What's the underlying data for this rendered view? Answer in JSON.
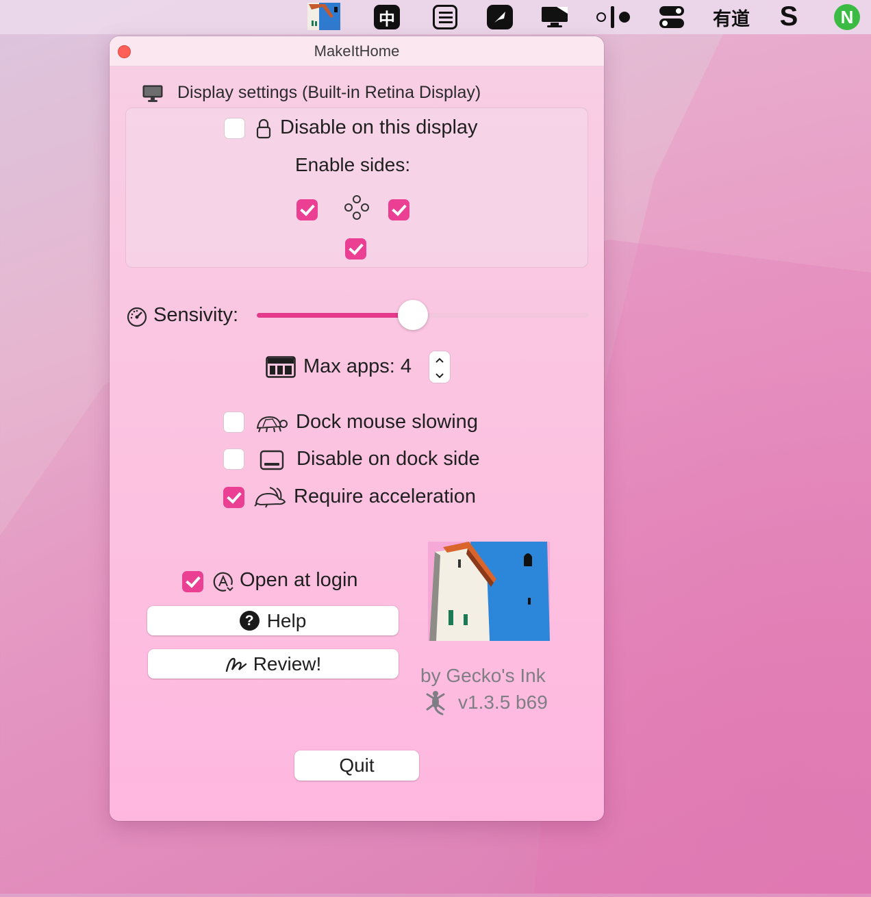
{
  "menubar": {
    "items": [
      {
        "name": "makeithome-app-icon"
      },
      {
        "name": "chinese-input-icon",
        "label": "中"
      },
      {
        "name": "list-icon"
      },
      {
        "name": "feather-icon"
      },
      {
        "name": "display-icon"
      },
      {
        "name": "dots-icon"
      },
      {
        "name": "toggle-icon"
      },
      {
        "name": "youdao-icon",
        "label": "有道"
      },
      {
        "name": "s-app-icon",
        "label": "S"
      },
      {
        "name": "n-app-icon",
        "label": "N"
      }
    ]
  },
  "window": {
    "title": "MakeItHome",
    "display_section": {
      "header": "Display settings (Built-in Retina Display)",
      "disable_on_display": {
        "label": "Disable on this display",
        "checked": false
      },
      "enable_sides_label": "Enable sides:",
      "sides": {
        "left": true,
        "right": true,
        "bottom": true
      }
    },
    "sensitivity": {
      "label": "Sensivity:",
      "value_fraction": 0.47
    },
    "max_apps": {
      "label": "Max apps: 4"
    },
    "options": [
      {
        "key": "dock_mouse_slowing",
        "label": "Dock mouse slowing",
        "checked": false,
        "icon": "turtle-icon"
      },
      {
        "key": "disable_on_dock_side",
        "label": "Disable on dock side",
        "checked": false,
        "icon": "dock-icon"
      },
      {
        "key": "require_acceleration",
        "label": "Require acceleration",
        "checked": true,
        "icon": "rabbit-icon"
      }
    ],
    "open_at_login": {
      "label": "Open at login",
      "checked": true
    },
    "buttons": {
      "help": "Help",
      "review": "Review!",
      "quit": "Quit"
    },
    "credit": {
      "author": "by Gecko's Ink",
      "version": "v1.3.5 b69"
    }
  },
  "colors": {
    "accent": "#ea3f92",
    "window_bg": "#fcc1e0",
    "close": "#fe5f57"
  }
}
